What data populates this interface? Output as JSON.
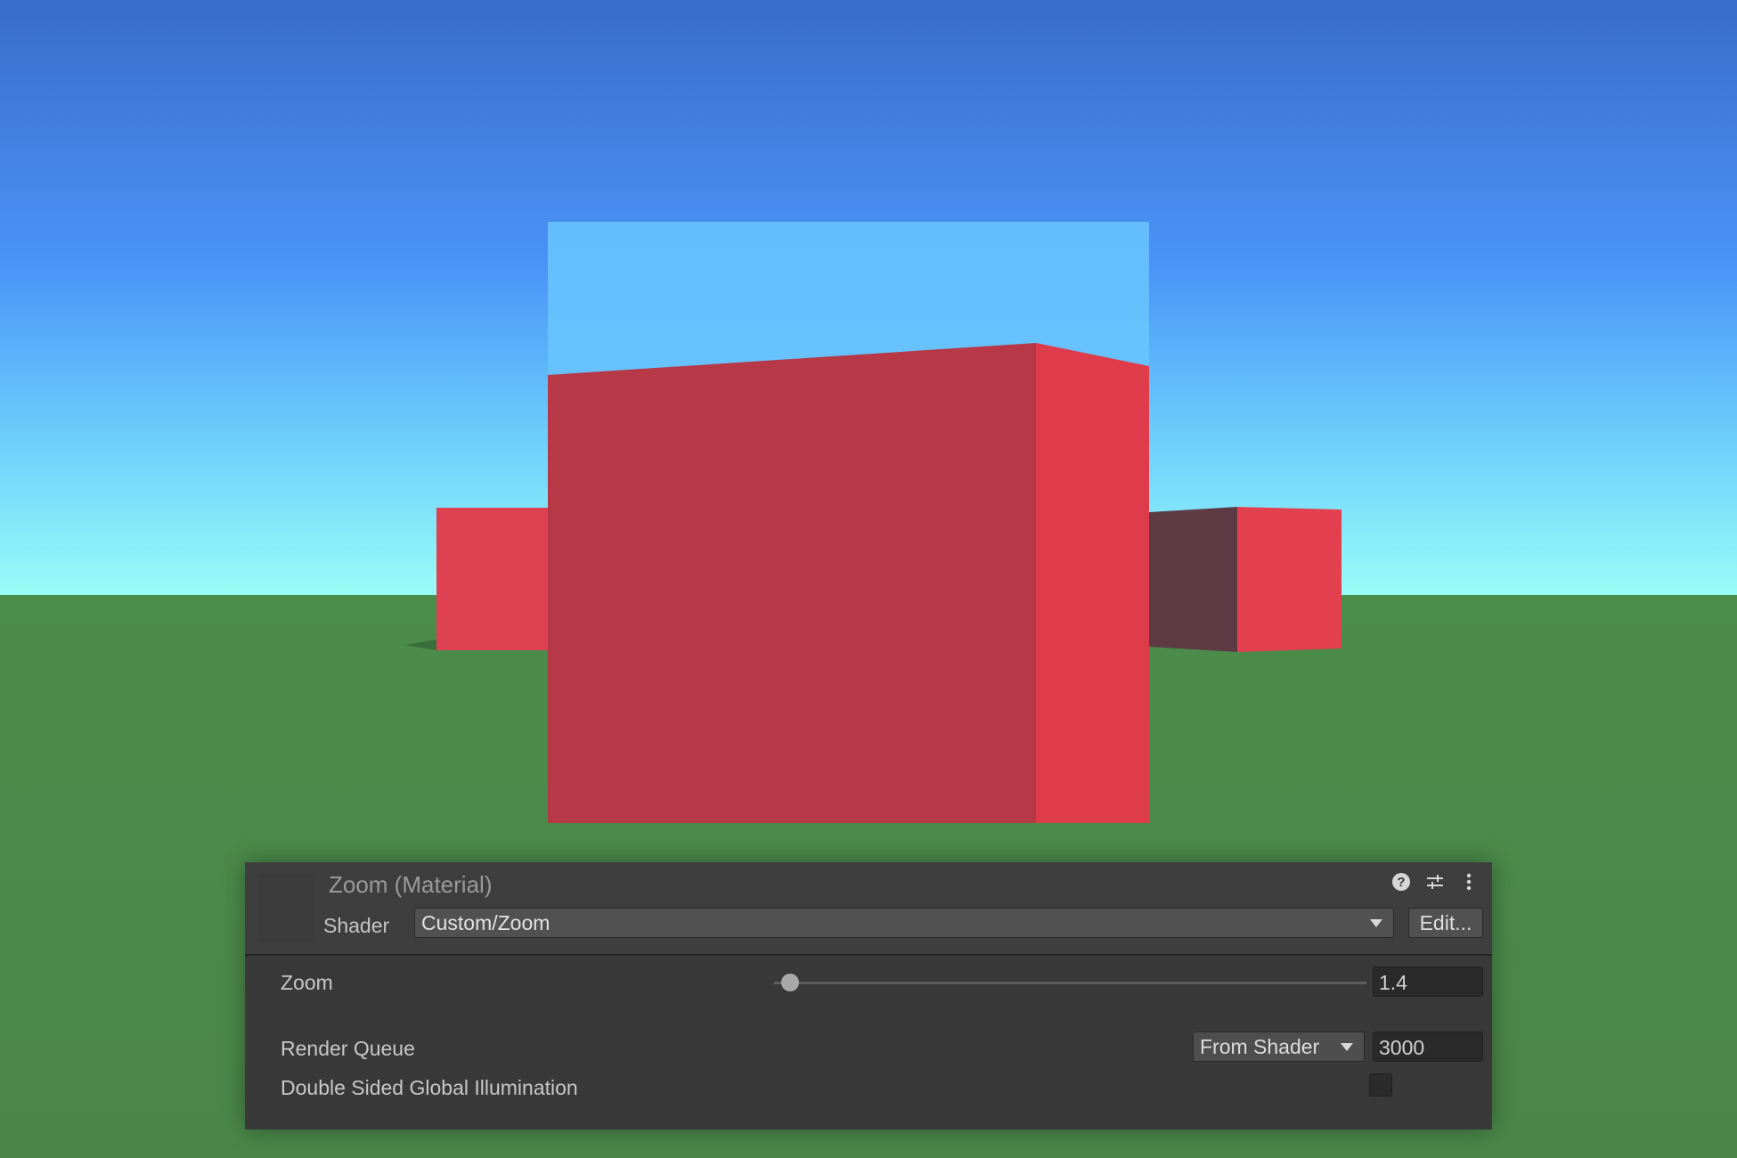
{
  "material": {
    "title": "Zoom (Material)",
    "shader_label": "Shader",
    "shader_value": "Custom/Zoom",
    "edit_label": "Edit..."
  },
  "header_icons": [
    "help-icon",
    "preset-sliders-icon",
    "more-menu-icon"
  ],
  "properties": {
    "zoom": {
      "label": "Zoom",
      "value": "1.4"
    },
    "render_queue": {
      "label": "Render Queue",
      "mode": "From Shader",
      "value": "3000"
    },
    "double_sided_gi": {
      "label": "Double Sided Global Illumination",
      "checked": false
    }
  },
  "colors": {
    "sky_top": "#3b6fcb",
    "sky_horizon": "#96fbf5",
    "ground": "#4a8a4b",
    "cube_front": "#b73846",
    "cube_side": "#de3b4c",
    "zoom_sky": "#67c2fd",
    "panel_bg": "#393939"
  }
}
